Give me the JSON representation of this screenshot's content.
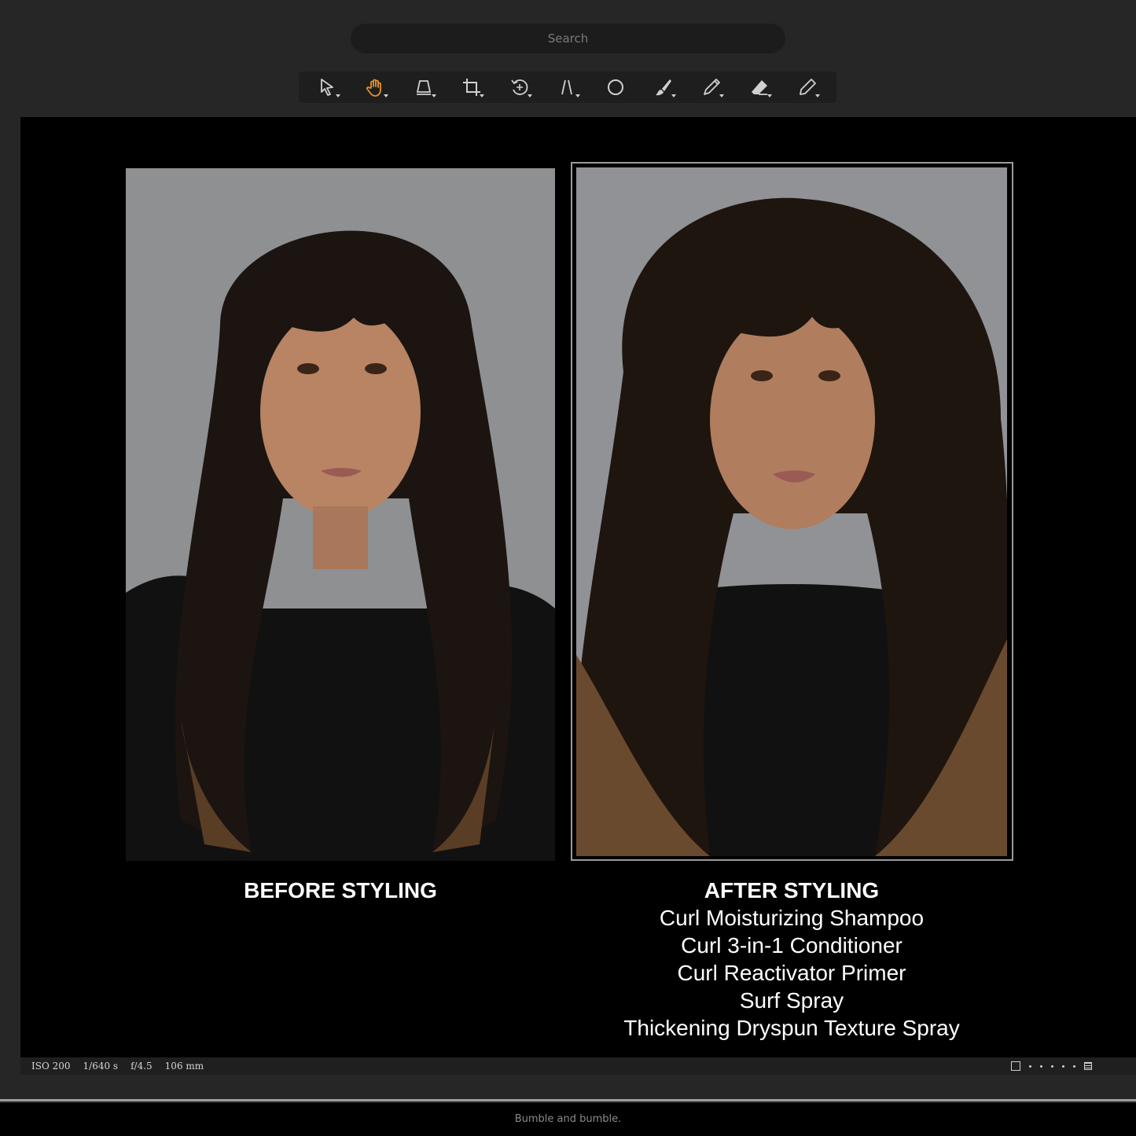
{
  "search": {
    "placeholder": "Search"
  },
  "toolbar": {
    "tools": [
      {
        "icon": "select-arrow-icon",
        "active": false
      },
      {
        "icon": "hand-pan-icon",
        "active": true
      },
      {
        "icon": "perspective-icon",
        "active": false
      },
      {
        "icon": "crop-icon",
        "active": false
      },
      {
        "icon": "rotate-icon",
        "active": false
      },
      {
        "icon": "straighten-icon",
        "active": false
      },
      {
        "icon": "circle-icon",
        "active": false
      },
      {
        "icon": "brush-icon",
        "active": false
      },
      {
        "icon": "pen-icon",
        "active": false
      },
      {
        "icon": "eraser-icon",
        "active": false
      },
      {
        "icon": "pencil-icon",
        "active": false
      }
    ],
    "active_color": "#e8912a"
  },
  "before": {
    "title": "BEFORE STYLING"
  },
  "after": {
    "title": "AFTER STYLING",
    "products": [
      "Curl Moisturizing Shampoo",
      "Curl 3-in-1 Conditioner",
      "Curl Reactivator Primer",
      "Surf Spray",
      "Thickening Dryspun Texture Spray"
    ]
  },
  "status": {
    "iso": "ISO 200",
    "shutter": "1/640 s",
    "aperture": "f/4.5",
    "focal": "106 mm"
  },
  "footer": {
    "text": "Bumble and bumble."
  }
}
